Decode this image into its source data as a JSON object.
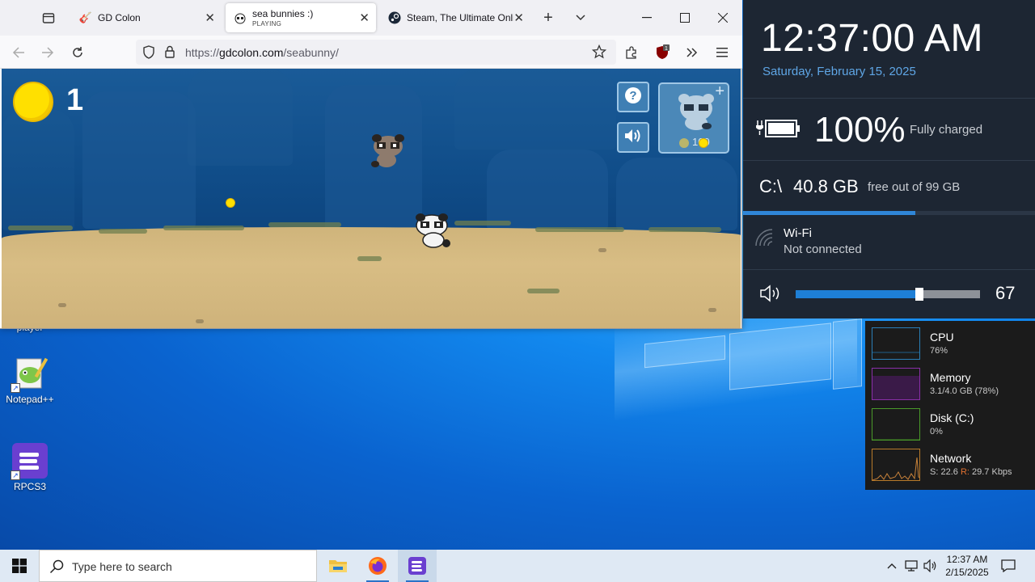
{
  "browser": {
    "tabs": [
      {
        "title": "GD Colon",
        "subtitle": ""
      },
      {
        "title": "sea bunnies :)",
        "subtitle": "PLAYING"
      },
      {
        "title": "Steam, The Ultimate Onli",
        "subtitle": ""
      }
    ],
    "url_prefix": "https://",
    "url_host": "gdcolon.com",
    "url_path": "/seabunny/",
    "extension_badge": "1"
  },
  "game": {
    "coin_count": "1",
    "shop_price": "100"
  },
  "desktop": {
    "icons": [
      {
        "label": "player"
      },
      {
        "label": "Notepad++"
      },
      {
        "label": "RPCS3"
      }
    ]
  },
  "info_panel": {
    "time": "12:37:00 AM",
    "date": "Saturday, February 15, 2025",
    "battery_percent": "100%",
    "battery_status": "Fully charged",
    "disk_label": "C:\\",
    "disk_free": "40.8 GB",
    "disk_info": "free out of 99 GB",
    "disk_used_fraction": 0.59,
    "wifi_title": "Wi-Fi",
    "wifi_status": "Not connected",
    "volume": "67",
    "volume_fraction": 0.67
  },
  "perf": [
    {
      "name": "CPU",
      "value": "76%",
      "color": "#2a7fb8"
    },
    {
      "name": "Memory",
      "value": "3.1/4.0 GB (78%)",
      "color": "#8a2fa8"
    },
    {
      "name": "Disk (C:)",
      "value": "0%",
      "color": "#4a9a2a"
    },
    {
      "name": "Network",
      "value_s_label": "S:",
      "value_s": "22.6",
      "value_r_label": "R:",
      "value_r": "29.7 Kbps",
      "color": "#b87a2a"
    }
  ],
  "taskbar": {
    "search_placeholder": "Type here to search",
    "time": "12:37 AM",
    "date": "2/15/2025"
  }
}
